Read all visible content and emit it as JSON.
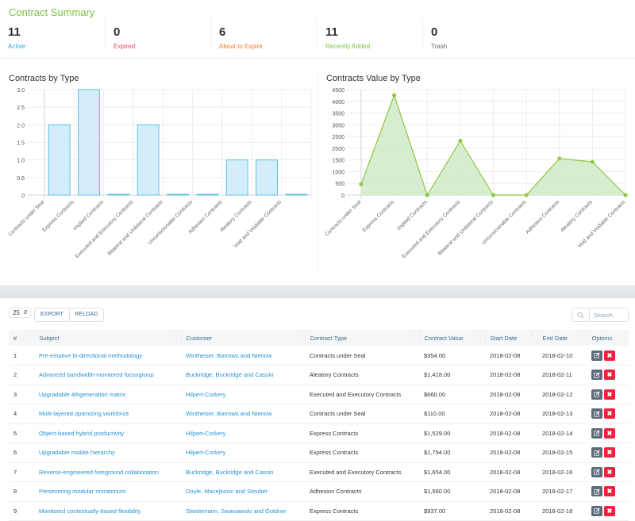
{
  "summary": {
    "title": "Contract Summary",
    "stats": [
      {
        "value": "11",
        "label": "Active",
        "color": "#2aaae2"
      },
      {
        "value": "0",
        "label": "Expired",
        "color": "#f24966"
      },
      {
        "value": "6",
        "label": "About to Expire",
        "color": "#f47b23"
      },
      {
        "value": "11",
        "label": "Recently Added",
        "color": "#7cc242"
      },
      {
        "value": "0",
        "label": "Trash",
        "color": "#666b70"
      }
    ]
  },
  "chart_data": [
    {
      "type": "bar",
      "title": "Contracts by Type",
      "categories": [
        "Contracts under Seal",
        "Express Contracts",
        "Implied Contracts",
        "Executed and Executory Contracts",
        "Bilateral and Unilateral Contracts",
        "Unconscionable Contracts",
        "Adhesion Contracts",
        "Aleatory Contracts",
        "Void and Voidable Contracts"
      ],
      "values": [
        2,
        3,
        0,
        2,
        0,
        0,
        1,
        1,
        0
      ],
      "yticks": [
        "0",
        "0.5",
        "1.0",
        "1.5",
        "2.0",
        "2.5",
        "3.0"
      ],
      "ylim": [
        0,
        3
      ],
      "xlabel": "",
      "ylabel": "",
      "grid": true,
      "color": "#5bc0eb",
      "fill": "#d4edfa"
    },
    {
      "type": "area",
      "title": "Contracts Value by Type",
      "categories": [
        "Contracts under Seal",
        "Express Contracts",
        "Implied Contracts",
        "Executed and Executory Contracts",
        "Bilateral and Unilateral Contracts",
        "Unconscionable Contracts",
        "Adhesion Contracts",
        "Aleatory Contracts",
        "Void and Voidable Contracts"
      ],
      "values": [
        464,
        4260,
        0,
        2314,
        0,
        0,
        1560,
        1418,
        0
      ],
      "yticks": [
        "0",
        "500",
        "1000",
        "1500",
        "2000",
        "2500",
        "3000",
        "3500",
        "4000",
        "4500"
      ],
      "ylim": [
        0,
        4500
      ],
      "xlabel": "",
      "ylabel": "",
      "grid": true,
      "color": "#8cc63f",
      "fill": "#d3ebcb"
    }
  ],
  "toolbar": {
    "page_size": "25",
    "export_label": "EXPORT",
    "reload_label": "RELOAD",
    "search_placeholder": "Search..."
  },
  "table": {
    "columns": [
      "#",
      "Subject",
      "Customer",
      "Contract Type",
      "Contract Value",
      "Start Date",
      "End Date",
      "Options"
    ],
    "rows": [
      {
        "id": "1",
        "subject": "Pre-emptive bi-directional methodology",
        "customer": "Wintheiser, Barrows and Nienow",
        "type": "Contracts under Seal",
        "value": "$354.00",
        "start": "2018-02-08",
        "end": "2018-02-10"
      },
      {
        "id": "2",
        "subject": "Advanced bandwidth-monitored focusgroup",
        "customer": "Buckridge, Buckridge and Cassin",
        "type": "Aleatory Contracts",
        "value": "$1,418.00",
        "start": "2018-02-08",
        "end": "2018-02-11"
      },
      {
        "id": "3",
        "subject": "Upgradable 4thgeneration matrix",
        "customer": "Hilpert-Corkery",
        "type": "Executed and Executory Contracts",
        "value": "$660.00",
        "start": "2018-02-08",
        "end": "2018-02-12"
      },
      {
        "id": "4",
        "subject": "Multi-layered optimizing workforce",
        "customer": "Wintheiser, Barrows and Nienow",
        "type": "Contracts under Seal",
        "value": "$110.00",
        "start": "2018-02-08",
        "end": "2018-02-13"
      },
      {
        "id": "5",
        "subject": "Object-based hybrid productivity",
        "customer": "Hilpert-Corkery",
        "type": "Express Contracts",
        "value": "$1,529.00",
        "start": "2018-02-08",
        "end": "2018-02-14"
      },
      {
        "id": "6",
        "subject": "Upgradable mobile hierarchy",
        "customer": "Hilpert-Corkery",
        "type": "Express Contracts",
        "value": "$1,794.00",
        "start": "2018-02-08",
        "end": "2018-02-15"
      },
      {
        "id": "7",
        "subject": "Reverse-engineered foreground collaboration",
        "customer": "Buckridge, Buckridge and Cassin",
        "type": "Executed and Executory Contracts",
        "value": "$1,654.00",
        "start": "2018-02-08",
        "end": "2018-02-16"
      },
      {
        "id": "8",
        "subject": "Persevering modular moratorium",
        "customer": "Doyle, Macejkovic and Steuber",
        "type": "Adhesion Contracts",
        "value": "$1,560.00",
        "start": "2018-02-08",
        "end": "2018-02-17"
      },
      {
        "id": "9",
        "subject": "Monitored contextually-based flexibility",
        "customer": "Stiedemann, Swaniawski and Goldner",
        "type": "Express Contracts",
        "value": "$937.00",
        "start": "2018-02-08",
        "end": "2018-02-18"
      }
    ],
    "edit_icon": "edit-icon",
    "delete_icon": "close-icon"
  }
}
